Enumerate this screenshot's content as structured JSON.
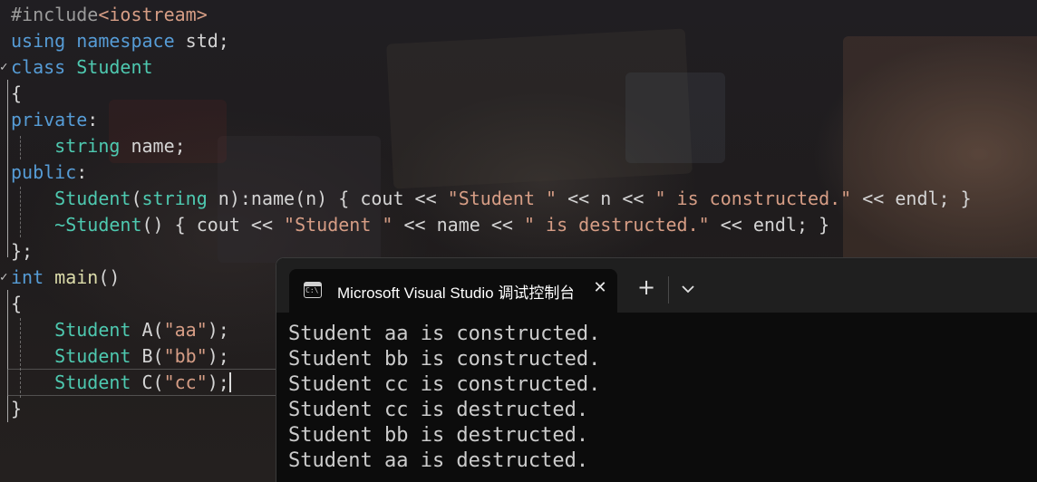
{
  "editor": {
    "lines": [
      {
        "segments": [
          {
            "t": "#include",
            "c": "pp"
          },
          {
            "t": "<iostream>",
            "c": "inc"
          }
        ]
      },
      {
        "segments": [
          {
            "t": "using",
            "c": "kw"
          },
          {
            "t": " ",
            "c": "df"
          },
          {
            "t": "namespace",
            "c": "kw"
          },
          {
            "t": " std;",
            "c": "df"
          }
        ]
      },
      {
        "segments": [
          {
            "t": "class",
            "c": "kw"
          },
          {
            "t": " ",
            "c": "df"
          },
          {
            "t": "Student",
            "c": "ty"
          }
        ]
      },
      {
        "segments": [
          {
            "t": "{",
            "c": "df"
          }
        ]
      },
      {
        "segments": [
          {
            "t": "private",
            "c": "kw"
          },
          {
            "t": ":",
            "c": "df"
          }
        ]
      },
      {
        "segments": [
          {
            "t": "    ",
            "c": "df"
          },
          {
            "t": "string",
            "c": "ty"
          },
          {
            "t": " name;",
            "c": "df"
          }
        ]
      },
      {
        "segments": [
          {
            "t": "public",
            "c": "kw"
          },
          {
            "t": ":",
            "c": "df"
          }
        ]
      },
      {
        "segments": [
          {
            "t": "    ",
            "c": "df"
          },
          {
            "t": "Student",
            "c": "ty"
          },
          {
            "t": "(",
            "c": "df"
          },
          {
            "t": "string",
            "c": "ty"
          },
          {
            "t": " n):name(n) { cout << ",
            "c": "df"
          },
          {
            "t": "\"Student \"",
            "c": "str"
          },
          {
            "t": " << n << ",
            "c": "df"
          },
          {
            "t": "\" is constructed.\"",
            "c": "str"
          },
          {
            "t": " << endl; }",
            "c": "df"
          }
        ]
      },
      {
        "segments": [
          {
            "t": "    ",
            "c": "df"
          },
          {
            "t": "~Student",
            "c": "ty"
          },
          {
            "t": "() { cout << ",
            "c": "df"
          },
          {
            "t": "\"Student \"",
            "c": "str"
          },
          {
            "t": " << name << ",
            "c": "df"
          },
          {
            "t": "\" is destructed.\"",
            "c": "str"
          },
          {
            "t": " << endl; }",
            "c": "df"
          }
        ]
      },
      {
        "segments": [
          {
            "t": "};",
            "c": "df"
          }
        ]
      },
      {
        "segments": [
          {
            "t": "int",
            "c": "kw"
          },
          {
            "t": " ",
            "c": "df"
          },
          {
            "t": "main",
            "c": "fn"
          },
          {
            "t": "()",
            "c": "df"
          }
        ]
      },
      {
        "segments": [
          {
            "t": "{",
            "c": "df"
          }
        ]
      },
      {
        "segments": [
          {
            "t": "    ",
            "c": "df"
          },
          {
            "t": "Student",
            "c": "ty"
          },
          {
            "t": " A(",
            "c": "df"
          },
          {
            "t": "\"aa\"",
            "c": "str"
          },
          {
            "t": ");",
            "c": "df"
          }
        ]
      },
      {
        "segments": [
          {
            "t": "    ",
            "c": "df"
          },
          {
            "t": "Student",
            "c": "ty"
          },
          {
            "t": " B(",
            "c": "df"
          },
          {
            "t": "\"bb\"",
            "c": "str"
          },
          {
            "t": ");",
            "c": "df"
          }
        ]
      },
      {
        "segments": [
          {
            "t": "    ",
            "c": "df"
          },
          {
            "t": "Student",
            "c": "ty"
          },
          {
            "t": " C(",
            "c": "df"
          },
          {
            "t": "\"cc\"",
            "c": "str"
          },
          {
            "t": ");",
            "c": "df"
          }
        ]
      },
      {
        "segments": [
          {
            "t": "}",
            "c": "df"
          }
        ]
      }
    ],
    "colors": {
      "keyword": "#569cd6",
      "type": "#4ec9b0",
      "function": "#dcdcaa",
      "string": "#d69d85",
      "preprocessor": "#9b9b9b",
      "default": "#d4d4d4"
    }
  },
  "terminal": {
    "tab_title": "Microsoft Visual Studio 调试控制台",
    "tab_icon": "console-icon",
    "close_icon": "close-icon",
    "new_tab_icon": "plus-icon",
    "dropdown_icon": "chevron-down-icon",
    "output_lines": [
      "Student aa is constructed.",
      "Student bb is constructed.",
      "Student cc is constructed.",
      "Student cc is destructed.",
      "Student bb is destructed.",
      "Student aa is destructed."
    ]
  }
}
